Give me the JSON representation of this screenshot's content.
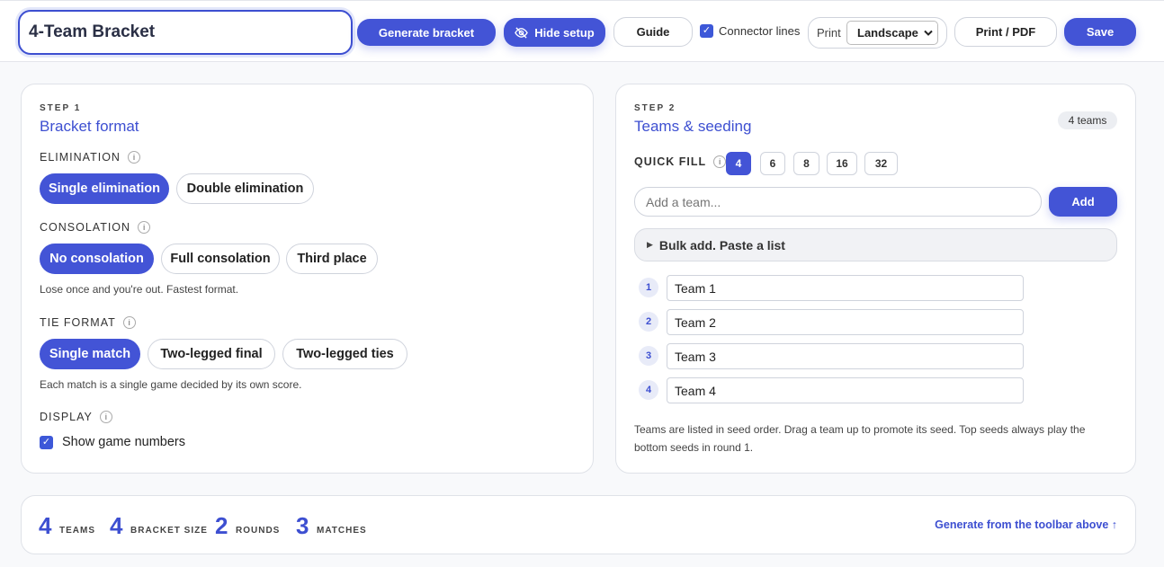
{
  "toolbar": {
    "title_value": "4-Team Bracket",
    "generate_label": "Generate bracket",
    "hide_setup_label": "Hide setup",
    "guide_label": "Guide",
    "connector_label": "Connector lines",
    "connector_checked": true,
    "print_label": "Print",
    "print_orientation": "Landscape",
    "print_pdf_label": "Print / PDF",
    "save_label": "Save"
  },
  "step1": {
    "step": "STEP 1",
    "title": "Bracket format",
    "elimination": {
      "label": "ELIMINATION",
      "options": [
        "Single elimination",
        "Double elimination"
      ],
      "selected": "Single elimination"
    },
    "consolation": {
      "label": "CONSOLATION",
      "options": [
        "No consolation",
        "Full consolation",
        "Third place"
      ],
      "selected": "No consolation",
      "note": "Lose once and you're out. Fastest format."
    },
    "tie_format": {
      "label": "TIE FORMAT",
      "options": [
        "Single match",
        "Two-legged final",
        "Two-legged ties"
      ],
      "selected": "Single match",
      "note": "Each match is a single game decided by its own score."
    },
    "display": {
      "label": "DISPLAY",
      "show_game_numbers": "Show game numbers",
      "checked": true
    }
  },
  "step2": {
    "step": "STEP 2",
    "title": "Teams & seeding",
    "team_count_badge": "4 teams",
    "quick_fill_label": "QUICK FILL",
    "quick_fill_options": [
      "4",
      "6",
      "8",
      "16",
      "32"
    ],
    "quick_fill_selected": "4",
    "add_placeholder": "Add a team...",
    "add_label": "Add",
    "bulk_label": "Bulk add. Paste a list",
    "teams": [
      {
        "seed": "1",
        "name": "Team 1"
      },
      {
        "seed": "2",
        "name": "Team 2"
      },
      {
        "seed": "3",
        "name": "Team 3"
      },
      {
        "seed": "4",
        "name": "Team 4"
      }
    ],
    "note": "Teams are listed in seed order. Drag a team up to promote its seed. Top seeds always play the bottom seeds in round 1."
  },
  "summary": {
    "teams_n": "4",
    "teams_l": "TEAMS",
    "size_n": "4",
    "size_l": "BRACKET SIZE",
    "rounds_n": "2",
    "rounds_l": "ROUNDS",
    "matches_n": "3",
    "matches_l": "MATCHES",
    "generate_link": "Generate from the toolbar above ↑"
  },
  "colors": {
    "accent": "#4354d6",
    "title": "#3d4fd1"
  }
}
